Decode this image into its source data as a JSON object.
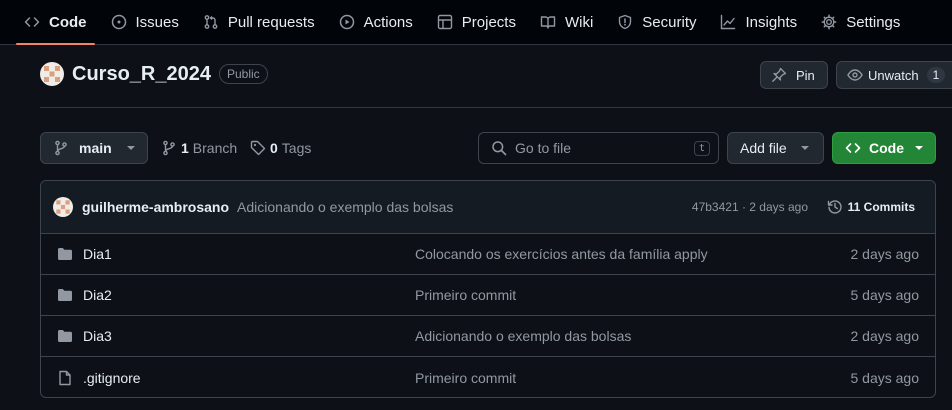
{
  "nav": {
    "tabs": [
      {
        "label": "Code",
        "icon": "code-icon"
      },
      {
        "label": "Issues",
        "icon": "issue-icon"
      },
      {
        "label": "Pull requests",
        "icon": "pull-request-icon"
      },
      {
        "label": "Actions",
        "icon": "play-icon"
      },
      {
        "label": "Projects",
        "icon": "table-icon"
      },
      {
        "label": "Wiki",
        "icon": "book-icon"
      },
      {
        "label": "Security",
        "icon": "shield-icon"
      },
      {
        "label": "Insights",
        "icon": "graph-icon"
      },
      {
        "label": "Settings",
        "icon": "gear-icon"
      }
    ]
  },
  "repo": {
    "name": "Curso_R_2024",
    "visibility": "Public",
    "pin_label": "Pin",
    "watch_label": "Unwatch",
    "watch_count": "1"
  },
  "toolbar": {
    "branch": "main",
    "branch_count": "1",
    "branch_label": "Branch",
    "tag_count": "0",
    "tag_label": "Tags",
    "search_placeholder": "Go to file",
    "search_shortcut": "t",
    "add_file_label": "Add file",
    "code_label": "Code"
  },
  "latest_commit": {
    "author": "guilherme-ambrosano",
    "message": "Adicionando o exemplo das bolsas",
    "hash_time": "47b3421 · 2 days ago",
    "commits_label": "11 Commits"
  },
  "files": [
    {
      "name": "Dia1",
      "type": "folder",
      "message": "Colocando os exercícios antes da família apply",
      "date": "2 days ago"
    },
    {
      "name": "Dia2",
      "type": "folder",
      "message": "Primeiro commit",
      "date": "5 days ago"
    },
    {
      "name": "Dia3",
      "type": "folder",
      "message": "Adicionando o exemplo das bolsas",
      "date": "2 days ago"
    },
    {
      "name": ".gitignore",
      "type": "file",
      "message": "Primeiro commit",
      "date": "5 days ago"
    }
  ],
  "colors": {
    "background": "#0d1117",
    "accent_underline": "#f78166",
    "primary_button": "#238636"
  }
}
